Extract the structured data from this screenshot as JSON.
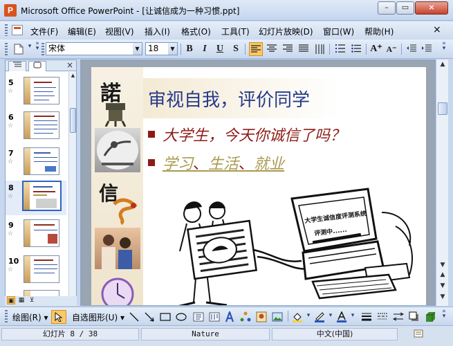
{
  "window": {
    "title": "Microsoft Office PowerPoint - [让诚信成为一种习惯.ppt]",
    "minimize": "–",
    "restore": "▭",
    "close": "×"
  },
  "menubar": {
    "items": [
      {
        "label": "文件(F)"
      },
      {
        "label": "编辑(E)"
      },
      {
        "label": "视图(V)"
      },
      {
        "label": "插入(I)"
      },
      {
        "label": "格式(O)"
      },
      {
        "label": "工具(T)"
      },
      {
        "label": "幻灯片放映(D)"
      },
      {
        "label": "窗口(W)"
      },
      {
        "label": "帮助(H)"
      }
    ],
    "close_label": "×"
  },
  "formatting": {
    "font_name": "宋体",
    "font_size": "18",
    "bold": "B",
    "italic": "I",
    "underline": "U",
    "shadow": "S",
    "grow_font": "A⁺",
    "shrink_font": "A⁻"
  },
  "slides_panel": {
    "tab_outline_icon": "outline-icon",
    "tab_slides_icon": "slides-icon",
    "close": "×",
    "slides": [
      {
        "number": "5",
        "star": "☆"
      },
      {
        "number": "6",
        "star": "☆"
      },
      {
        "number": "7",
        "star": "☆"
      },
      {
        "number": "8",
        "star": "☆",
        "selected": true
      },
      {
        "number": "9",
        "star": "☆"
      },
      {
        "number": "10",
        "star": "☆"
      }
    ]
  },
  "slide": {
    "title": "审视自我，评价同学",
    "bullet1": "大学生，今天你诚信了吗？",
    "bullet2_parts": [
      "学习",
      "、",
      "生活",
      "、",
      "就业"
    ],
    "deco_char1": "諾",
    "deco_char2": "信",
    "monitor_title": "大学生诚信度评测系统",
    "monitor_status": "评测中......"
  },
  "drawing_toolbar": {
    "draw_label": "绘图(R)",
    "autoshapes_label": "自选图形(U)"
  },
  "status": {
    "slide_position": "幻灯片 8 / 38",
    "template": "Nature",
    "language": "中文(中国)"
  },
  "colors": {
    "title_blue": "#25398a",
    "bullet_red": "#8e1b16",
    "link_olive": "#a89a4e",
    "selection_orange": "#f9c86a"
  }
}
